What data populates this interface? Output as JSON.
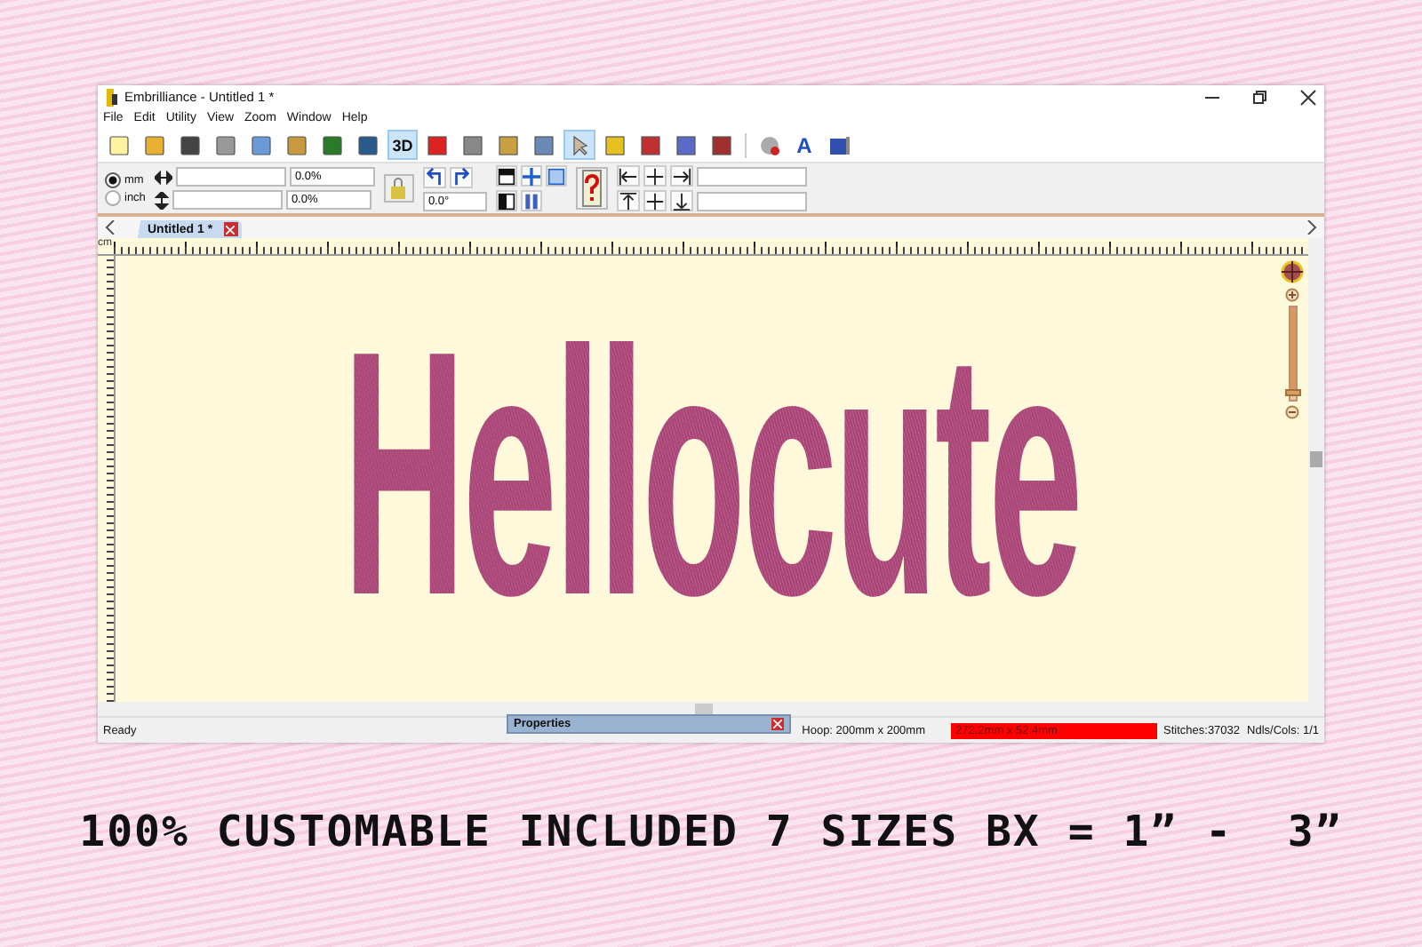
{
  "window": {
    "title": "Embrilliance - Untitled 1 *"
  },
  "menu": [
    "File",
    "Edit",
    "Utility",
    "View",
    "Zoom",
    "Window",
    "Help"
  ],
  "toolbar": {
    "three_d_label": "3D",
    "three_d_pressed": true,
    "select_pressed": true,
    "text_tool_label": "A"
  },
  "property_bar": {
    "units": [
      {
        "label": "mm",
        "selected": true
      },
      {
        "label": "inch",
        "selected": false
      }
    ],
    "width_percent": "0.0%",
    "height_percent": "0.0%",
    "rotation": "0.0°"
  },
  "tabs": [
    {
      "label": "Untitled 1 *",
      "selected": true
    }
  ],
  "ruler": {
    "unit": "cm"
  },
  "canvas": {
    "design_text": "Hellocute",
    "zoom_slider": {
      "level": 0.95
    }
  },
  "properties_panel": {
    "title": "Properties"
  },
  "status_bar": {
    "message": "Ready",
    "hoop": "Hoop: 200mm x 200mm",
    "size": "272.2mm x 52.4mm",
    "size_warning": true,
    "stitches": "Stitches:37032",
    "needles": "Ndls/Cols: 1/1"
  },
  "caption": "100% CUSTOMABLE INCLUDED 7 SIZES BX = 1” -  3”"
}
